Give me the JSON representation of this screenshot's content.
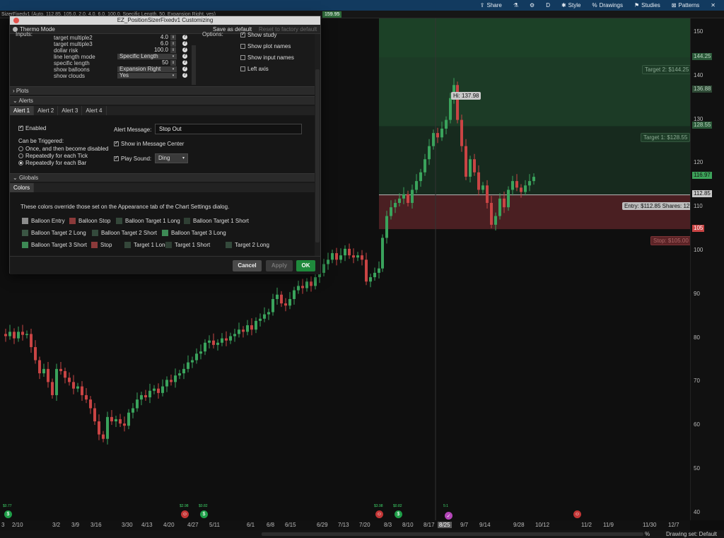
{
  "toolbar": {
    "items": [
      {
        "icon": "share-icon",
        "glyph": "⇪",
        "label": "Share"
      },
      {
        "icon": "flask-icon",
        "glyph": "⚗",
        "label": ""
      },
      {
        "icon": "gear-icon",
        "glyph": "⚙",
        "label": ""
      },
      {
        "icon": "d-icon",
        "glyph": "D",
        "label": ""
      },
      {
        "icon": "style-icon",
        "glyph": "✱",
        "label": "Style"
      },
      {
        "icon": "drawings-icon",
        "glyph": "%",
        "label": "Drawings"
      },
      {
        "icon": "studies-icon",
        "glyph": "⚑",
        "label": "Studies"
      },
      {
        "icon": "patterns-icon",
        "glyph": "⊠",
        "label": "Patterns"
      },
      {
        "icon": "close-icon",
        "glyph": "✕",
        "label": ""
      }
    ]
  },
  "subbar": {
    "title": "SizerFixedv1 (Auto, 112.85, 105.0, 2.0, 4.0, 6.0, 100.0, Specific Length, 50, Expansion Right, yes)",
    "quote_last": "159.95"
  },
  "dialog": {
    "title": "EZ_PositionSizerFixedv1 Customizing",
    "thermo_label": "Thermo Mode",
    "save_default": "Save as default",
    "reset_default": "Reset to factory default",
    "inputs_label": "Inputs:",
    "options_label": "Options:",
    "inputs": [
      {
        "key": "target multiple2",
        "value": "4.0",
        "type": "spin"
      },
      {
        "key": "target multiple3",
        "value": "6.0",
        "type": "spin"
      },
      {
        "key": "dollar risk",
        "value": "100.0",
        "type": "spin"
      },
      {
        "key": "line length mode",
        "value": "Specific Length",
        "type": "dd"
      },
      {
        "key": "specific length",
        "value": "50",
        "type": "spin"
      },
      {
        "key": "show balloons",
        "value": "Expansion Right",
        "type": "dd"
      },
      {
        "key": "show clouds",
        "value": "Yes",
        "type": "dd"
      }
    ],
    "options": [
      {
        "label": "Show study",
        "checked": true
      },
      {
        "label": "Show plot names",
        "checked": false
      },
      {
        "label": "Show input names",
        "checked": false
      },
      {
        "label": "Left axis",
        "checked": false
      }
    ],
    "plots_label": "Plots",
    "alerts_label": "Alerts",
    "alert_tabs": [
      "Alert 1",
      "Alert 2",
      "Alert 3",
      "Alert 4"
    ],
    "alert": {
      "enabled_label": "Enabled",
      "enabled": true,
      "triggered_label": "Can be Triggered:",
      "triggers": [
        {
          "label": "Once, and then become disabled",
          "checked": false
        },
        {
          "label": "Repeatedly for each Tick",
          "checked": false
        },
        {
          "label": "Repeatedly for each Bar",
          "checked": true
        }
      ],
      "message_label": "Alert Message:",
      "message_value": "Stop Out",
      "show_center_label": "Show in Message Center",
      "play_sound_label": "Play Sound:",
      "sound_value": "Ding"
    },
    "globals_label": "Globals",
    "colors_tab": "Colors",
    "colors_note": "These colors override those set on the Appearance tab of the Chart Settings dialog.",
    "swatches": [
      {
        "label": "Balloon Entry",
        "color": "#8c8c8c"
      },
      {
        "label": "Balloon Stop",
        "color": "#8b3a3a"
      },
      {
        "label": "Balloon Target 1 Long",
        "color": "#34473a"
      },
      {
        "label": "Balloon Target 1 Short",
        "color": "#2f3f34"
      },
      {
        "label": "Balloon Target 2 Long",
        "color": "#3b5644"
      },
      {
        "label": "Balloon Target 2 Short",
        "color": "#344a3c"
      },
      {
        "label": "Balloon Target 3 Long",
        "color": "#3d8a55"
      },
      {
        "label": "Balloon Target 3 Short",
        "color": "#3d8a55"
      },
      {
        "label": "Stop",
        "color": "#8b3a3a"
      },
      {
        "label": "Target 1 Long",
        "color": "#34473a"
      },
      {
        "label": "Target 1 Short",
        "color": "#2f3f34"
      },
      {
        "label": "Target 2 Long",
        "color": "#344a3c"
      }
    ],
    "cancel": "Cancel",
    "apply": "Apply",
    "ok": "OK"
  },
  "chart": {
    "y_ticks": [
      "150",
      "140",
      "130",
      "120",
      "110",
      "100",
      "90",
      "80",
      "70",
      "60",
      "50",
      "40"
    ],
    "x_ticks": [
      {
        "label": "3",
        "highlight": false
      },
      {
        "label": "2/10",
        "highlight": false
      },
      {
        "label": "3/2",
        "highlight": false
      },
      {
        "label": "3/9",
        "highlight": false
      },
      {
        "label": "3/16",
        "highlight": false
      },
      {
        "label": "3/30",
        "highlight": false
      },
      {
        "label": "4/13",
        "highlight": false
      },
      {
        "label": "4/20",
        "highlight": false
      },
      {
        "label": "4/27",
        "highlight": false
      },
      {
        "label": "5/11",
        "highlight": false
      },
      {
        "label": "6/1",
        "highlight": false
      },
      {
        "label": "6/8",
        "highlight": false
      },
      {
        "label": "6/15",
        "highlight": false
      },
      {
        "label": "6/29",
        "highlight": false
      },
      {
        "label": "7/13",
        "highlight": false
      },
      {
        "label": "7/20",
        "highlight": false
      },
      {
        "label": "8/3",
        "highlight": false
      },
      {
        "label": "8/10",
        "highlight": false
      },
      {
        "label": "8/17",
        "highlight": false
      },
      {
        "label": "8/25",
        "highlight": true
      },
      {
        "label": "9/7",
        "highlight": false
      },
      {
        "label": "9/14",
        "highlight": false
      },
      {
        "label": "9/28",
        "highlight": false
      },
      {
        "label": "10/12",
        "highlight": false
      },
      {
        "label": "11/2",
        "highlight": false
      },
      {
        "label": "11/9",
        "highlight": false
      },
      {
        "label": "11/30",
        "highlight": false
      },
      {
        "label": "12/7",
        "highlight": false
      }
    ],
    "price_tags": [
      {
        "value": "144.25",
        "color": "#2c5a3a"
      },
      {
        "value": "136.88",
        "color": "#2f4a36"
      },
      {
        "value": "128.55",
        "color": "#2c5a3a"
      },
      {
        "value": "116.97",
        "color": "#3da35a"
      },
      {
        "value": "112.85",
        "color": "#c9c9c9"
      },
      {
        "value": "105",
        "color": "#c94444"
      }
    ],
    "labels": {
      "target2": "Target 2: $144.25",
      "target1": "Target 1: $128.55",
      "entry": "Entry: $112.85 Shares: 12",
      "stop": "Stop: $105.00",
      "hi": "Hi: 137.98"
    },
    "events": [
      {
        "type": "g",
        "text": "$0.77"
      },
      {
        "type": "r",
        "text": "$2.98"
      },
      {
        "type": "g",
        "text": "$0.82"
      },
      {
        "type": "r",
        "text": "$3.98"
      },
      {
        "type": "g",
        "text": "$0.82"
      },
      {
        "type": "p",
        "text": "5:1"
      },
      {
        "type": "r",
        "text": ""
      }
    ],
    "colors": {
      "up": "#3aa35c",
      "down": "#c94444",
      "target_zone": "#1c3b26",
      "stop_zone": "#4a1f22"
    }
  },
  "bottom": {
    "zoom_icon": "%",
    "drawing_set": "Drawing set: Default"
  }
}
